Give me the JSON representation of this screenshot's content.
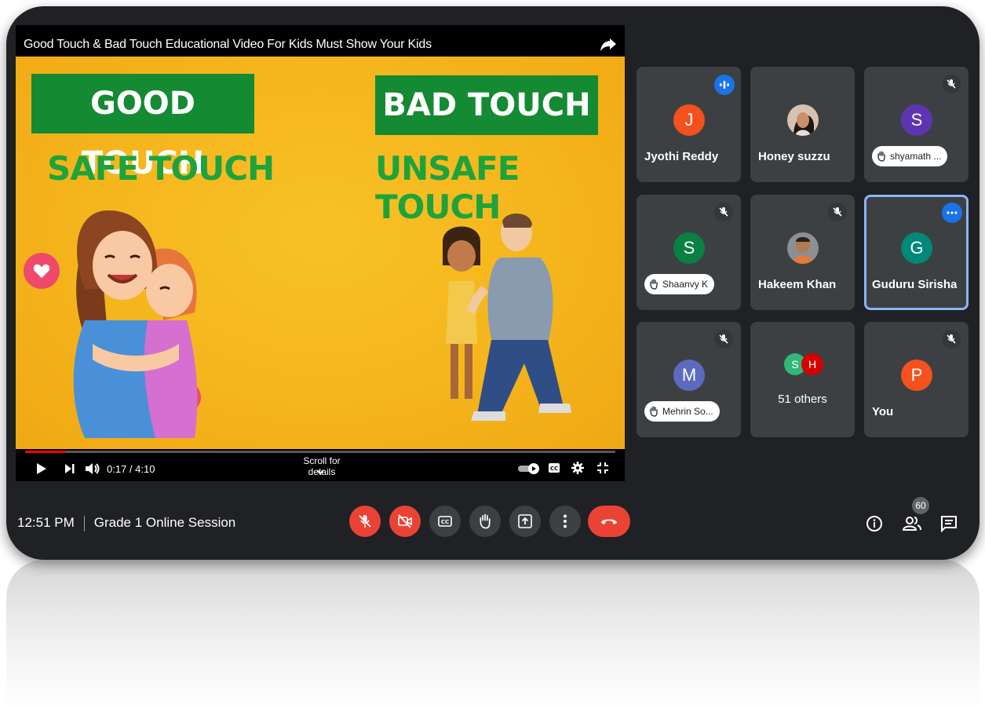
{
  "video": {
    "title": "Good Touch & Bad Touch Educational Video For Kids Must Show Your Kids",
    "sign_left": "GOOD TOUCH",
    "sign_right": "BAD TOUCH",
    "sub_left": "SAFE TOUCH",
    "sub_right": "UNSAFE TOUCH",
    "time": "0:17 / 4:10",
    "scroll_hint": "Scroll for details",
    "progress": 0.068
  },
  "participants": [
    {
      "name": "Jyothi Reddy",
      "initial": "J",
      "color": "#f4511e",
      "state": "speaking"
    },
    {
      "name": "Honey suzzu",
      "initial": "",
      "color": "",
      "state": "photo"
    },
    {
      "name": "shyamath ...",
      "initial": "S",
      "color": "#5e35b1",
      "state": "muted-hand"
    },
    {
      "name": "Shaanvy K",
      "initial": "S",
      "color": "#0b8043",
      "state": "muted-hand"
    },
    {
      "name": "Hakeem Khan",
      "initial": "",
      "color": "",
      "state": "photo-muted"
    },
    {
      "name": "Guduru Sirisha",
      "initial": "G",
      "color": "#00897b",
      "state": "active-more"
    },
    {
      "name": "Mehrin So...",
      "initial": "M",
      "color": "#5c6bc0",
      "state": "muted-hand"
    },
    {
      "name": "51 others",
      "initial": "",
      "color": "",
      "state": "others"
    },
    {
      "name": "You",
      "initial": "P",
      "color": "#f4511e",
      "state": "muted"
    }
  ],
  "others_avatars": [
    {
      "initial": "S",
      "color": "#33b679"
    },
    {
      "initial": "H",
      "color": "#d50000"
    }
  ],
  "meeting": {
    "time": "12:51 PM",
    "title": "Grade 1 Online Session",
    "people_count": "60"
  },
  "icons": {
    "share": "share-arrow-icon",
    "mic": "mic-off-icon",
    "camera": "camera-off-icon",
    "captions": "captions-icon",
    "hand": "raise-hand-icon",
    "present": "present-screen-icon",
    "more": "more-vert-icon",
    "hangup": "hangup-icon",
    "info": "info-icon",
    "people": "people-icon",
    "chat": "chat-icon"
  },
  "colors": {
    "background": "#202124",
    "tile": "#3c4043",
    "danger": "#ea4335",
    "accent": "#1a73e8",
    "active_border": "#8ab4f8"
  }
}
